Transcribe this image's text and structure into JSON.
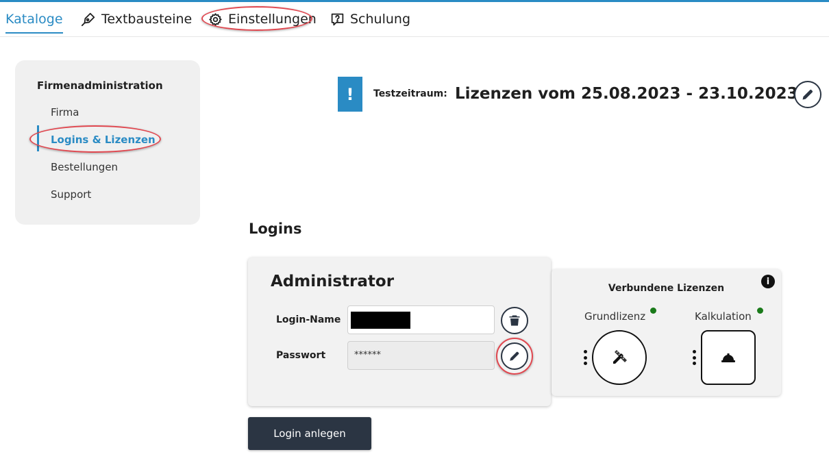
{
  "nav": {
    "items": [
      {
        "label": "Kataloge",
        "icon": "none"
      },
      {
        "label": "Textbausteine",
        "icon": "pen-nib-icon"
      },
      {
        "label": "Einstellungen",
        "icon": "gear-icon"
      },
      {
        "label": "Schulung",
        "icon": "question-chat-icon"
      }
    ],
    "active": "Kataloge",
    "accent": "#2a8bc4"
  },
  "sidebar": {
    "title": "Firmenadministration",
    "items": [
      {
        "label": "Firma"
      },
      {
        "label": "Logins & Lizenzen"
      },
      {
        "label": "Bestellungen"
      },
      {
        "label": "Support"
      }
    ],
    "active": "Logins & Lizenzen"
  },
  "trial": {
    "icon_text": "!",
    "label": "Testzeitraum:",
    "value": "Lizenzen vom 25.08.2023 - 23.10.2023"
  },
  "logins": {
    "heading": "Logins",
    "card": {
      "title": "Administrator",
      "login_name_label": "Login-Name",
      "login_name_value": "",
      "password_label": "Passwort",
      "password_value": "******"
    }
  },
  "licenses": {
    "title": "Verbundene Lizenzen",
    "info_icon_text": "i",
    "items": [
      {
        "label": "Grundlizenz",
        "status": "active",
        "status_color": "#1a7a1a",
        "icon": "pencil-ruler-icon"
      },
      {
        "label": "Kalkulation",
        "status": "active",
        "status_color": "#1a7a1a",
        "icon": "hard-hat-icon"
      }
    ]
  },
  "actions": {
    "create_login_label": "Login anlegen"
  },
  "colors": {
    "dark_button": "#2b3543",
    "highlight_ring": "#e0474f"
  }
}
